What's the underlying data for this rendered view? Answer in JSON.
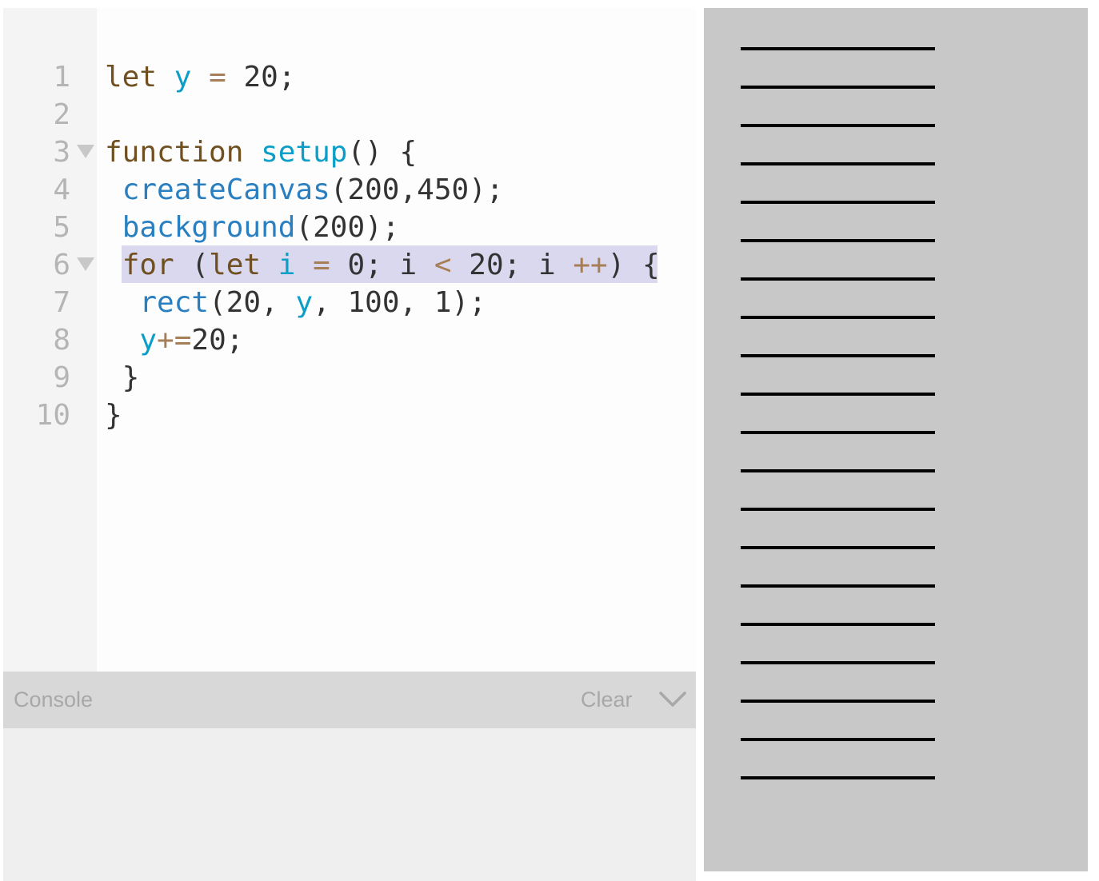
{
  "editor": {
    "line_numbers": [
      "1",
      "2",
      "3",
      "4",
      "5",
      "6",
      "7",
      "8",
      "9",
      "10"
    ],
    "fold_markers_on_lines": [
      3,
      6
    ],
    "highlighted_line": 6,
    "lines": [
      [
        {
          "t": "let",
          "c": "kw"
        },
        {
          "t": " ",
          "c": "pl"
        },
        {
          "t": "y",
          "c": "id"
        },
        {
          "t": " ",
          "c": "pl"
        },
        {
          "t": "=",
          "c": "op"
        },
        {
          "t": " 20;",
          "c": "pl"
        }
      ],
      [],
      [
        {
          "t": "function",
          "c": "kw"
        },
        {
          "t": " ",
          "c": "pl"
        },
        {
          "t": "setup",
          "c": "id"
        },
        {
          "t": "() {",
          "c": "pl"
        }
      ],
      [
        {
          "t": " ",
          "c": "pl"
        },
        {
          "t": "createCanvas",
          "c": "fn"
        },
        {
          "t": "(200,450);",
          "c": "pl"
        }
      ],
      [
        {
          "t": " ",
          "c": "pl"
        },
        {
          "t": "background",
          "c": "fn"
        },
        {
          "t": "(200);",
          "c": "pl"
        }
      ],
      [
        {
          "t": " ",
          "c": "pl"
        },
        {
          "t": "for",
          "c": "kw"
        },
        {
          "t": " (",
          "c": "pl"
        },
        {
          "t": "let",
          "c": "kw"
        },
        {
          "t": " ",
          "c": "pl"
        },
        {
          "t": "i",
          "c": "id"
        },
        {
          "t": " ",
          "c": "pl"
        },
        {
          "t": "=",
          "c": "op"
        },
        {
          "t": " 0; i ",
          "c": "pl"
        },
        {
          "t": "<",
          "c": "op"
        },
        {
          "t": " 20; i ",
          "c": "pl"
        },
        {
          "t": "++",
          "c": "op"
        },
        {
          "t": ") {",
          "c": "pl"
        }
      ],
      [
        {
          "t": "  ",
          "c": "pl"
        },
        {
          "t": "rect",
          "c": "fn"
        },
        {
          "t": "(20, ",
          "c": "pl"
        },
        {
          "t": "y",
          "c": "id"
        },
        {
          "t": ", 100, 1);",
          "c": "pl"
        }
      ],
      [
        {
          "t": "  ",
          "c": "pl"
        },
        {
          "t": "y",
          "c": "id"
        },
        {
          "t": "+=",
          "c": "op"
        },
        {
          "t": "20;",
          "c": "pl"
        }
      ],
      [
        {
          "t": " }",
          "c": "pl"
        }
      ],
      [
        {
          "t": "}",
          "c": "pl"
        }
      ]
    ]
  },
  "console": {
    "title": "Console",
    "clear_label": "Clear",
    "toggle_icon": "chevron-down-icon"
  },
  "preview": {
    "background_color": "#c8c8c8",
    "line_color": "#000000",
    "line_count": 20
  },
  "colors": {
    "keyword": "#704f21",
    "identifier": "#0b9fc8",
    "function": "#2a7fc0",
    "operator": "#a67f59",
    "plain": "#333333",
    "line_highlight": "#d9d8ee"
  }
}
